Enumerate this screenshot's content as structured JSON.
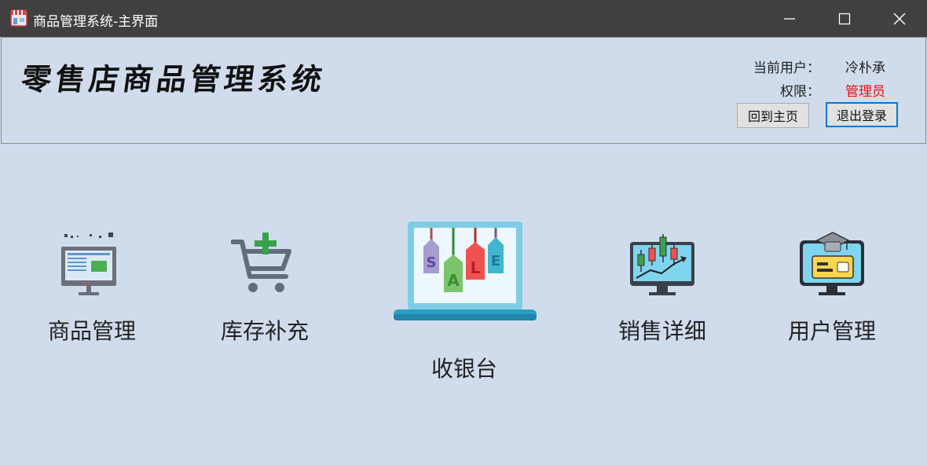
{
  "window": {
    "title": "商品管理系统-主界面",
    "controls": [
      "minimize",
      "maximize",
      "close"
    ]
  },
  "header": {
    "brand": "零售店商品管理系统",
    "user_label": "当前用户：",
    "user_value": "冷朴承",
    "role_label": "权限：",
    "role_value": "管理员",
    "home_button": "回到主页",
    "logout_button": "退出登录"
  },
  "features": {
    "products": {
      "label": "商品管理",
      "icon": "monitor-icon"
    },
    "stock": {
      "label": "库存补充",
      "icon": "cart-plus-icon"
    },
    "cashier": {
      "label": "收银台",
      "icon": "laptop-sale-icon"
    },
    "sales": {
      "label": "销售详细",
      "icon": "candlestick-chart-icon"
    },
    "users": {
      "label": "用户管理",
      "icon": "user-card-icon"
    }
  },
  "colors": {
    "accent": "#0078d7",
    "role": "#e81010",
    "background": "#d0dcec"
  }
}
